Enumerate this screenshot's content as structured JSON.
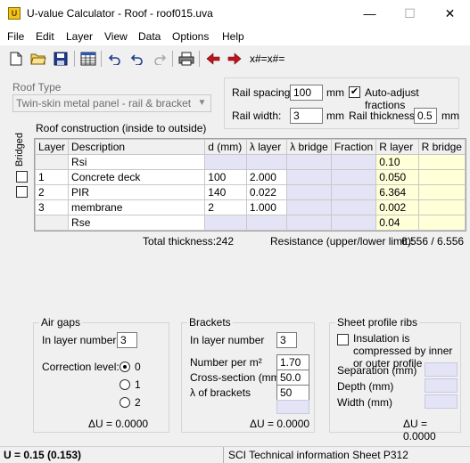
{
  "window": {
    "title": "U-value Calculator - Roof - roof015.uva",
    "minimize": "—",
    "maximize": "☐",
    "close": "✕"
  },
  "menu": [
    "File",
    "Edit",
    "Layer",
    "View",
    "Data",
    "Options",
    "Help"
  ],
  "toolbar": {
    "formula_text": "x#=x#="
  },
  "roof_type": {
    "label": "Roof Type",
    "value": "Twin-skin metal panel - rail & bracket system"
  },
  "rail": {
    "spacing_label": "Rail spacing:",
    "spacing_value": "100",
    "spacing_unit": "mm",
    "width_label": "Rail width:",
    "width_value": "3",
    "width_unit": "mm",
    "auto_adjust_label": "Auto-adjust fractions",
    "auto_adjust_checked": true,
    "thickness_label": "Rail thickness:",
    "thickness_value": "0.5",
    "thickness_unit": "mm"
  },
  "construction": {
    "title": "Roof construction (inside to outside)",
    "bridged_label": "Bridged",
    "columns": [
      "Layer",
      "Description",
      "d (mm)",
      "λ layer",
      "λ bridge",
      "Fraction",
      "R layer",
      "R bridge"
    ],
    "rows": [
      {
        "layer": "",
        "description": "Rsi",
        "d": "",
        "lambda": "",
        "lambda_bridge": "",
        "fraction": "",
        "r_layer": "0.10",
        "r_bridge": ""
      },
      {
        "layer": "1",
        "description": "Concrete deck",
        "d": "100",
        "lambda": "2.000",
        "lambda_bridge": "",
        "fraction": "",
        "r_layer": "0.050",
        "r_bridge": ""
      },
      {
        "layer": "2",
        "description": "PIR",
        "d": "140",
        "lambda": "0.022",
        "lambda_bridge": "",
        "fraction": "",
        "r_layer": "6.364",
        "r_bridge": ""
      },
      {
        "layer": "3",
        "description": "membrane",
        "d": "2",
        "lambda": "1.000",
        "lambda_bridge": "",
        "fraction": "",
        "r_layer": "0.002",
        "r_bridge": ""
      },
      {
        "layer": "",
        "description": "Rse",
        "d": "",
        "lambda": "",
        "lambda_bridge": "",
        "fraction": "",
        "r_layer": "0.04",
        "r_bridge": ""
      }
    ],
    "total_thickness_label": "Total thickness:",
    "total_thickness_value": "242",
    "resistance_label": "Resistance (upper/lower limit):",
    "resistance_value": "6.556 / 6.556"
  },
  "air_gaps": {
    "title": "Air gaps",
    "layer_label": "In layer number",
    "layer_value": "3",
    "correction_label": "Correction level:",
    "options": [
      "0",
      "1",
      "2"
    ],
    "selected": "0",
    "du": "ΔU =  0.0000"
  },
  "brackets": {
    "title": "Brackets",
    "layer_label": "In layer number",
    "layer_value": "3",
    "number_label": "Number per m²",
    "number_value": "1.70",
    "cross_label": "Cross-section (mm²)",
    "cross_value": "50.0",
    "lambda_label": "λ  of brackets",
    "lambda_value": "50",
    "du": "ΔU =  0.0000"
  },
  "ribs": {
    "title": "Sheet profile ribs",
    "compressed_label": "Insulation is compressed by inner or outer profile",
    "separation_label": "Separation (mm)",
    "depth_label": "Depth (mm)",
    "width_label": "Width (mm)",
    "du": "ΔU =  0.0000"
  },
  "status": {
    "u_value": "U = 0.15  (0.153)",
    "reference": "SCI Technical information Sheet P312"
  }
}
